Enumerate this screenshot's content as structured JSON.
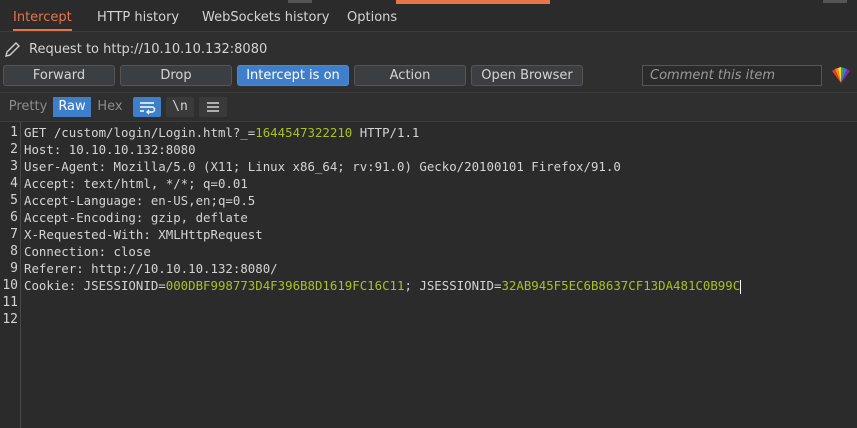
{
  "tabs": [
    {
      "label": "Intercept",
      "active": true
    },
    {
      "label": "HTTP history"
    },
    {
      "label": "WebSockets history"
    },
    {
      "label": "Options"
    }
  ],
  "request": {
    "title": "Request to http://10.10.10.132:8080"
  },
  "toolbar": {
    "forward": "Forward",
    "drop": "Drop",
    "intercept": "Intercept is on",
    "action": "Action",
    "open_browser": "Open Browser",
    "comment_placeholder": "Comment this item"
  },
  "view": {
    "pretty": "Pretty",
    "raw": "Raw",
    "hex": "Hex",
    "newline_toggle": "\\n",
    "selected": "Raw"
  },
  "colors": {
    "accent": "#e8744a",
    "selected": "#3f7fc9",
    "number_highlight": "#a8c023"
  },
  "editor": {
    "line_numbers": [
      "1",
      "2",
      "3",
      "4",
      "5",
      "6",
      "7",
      "8",
      "9",
      "10",
      "11",
      "12"
    ],
    "lines": [
      {
        "segments": [
          {
            "text": "GET /custom/login/Login.html?_="
          },
          {
            "text": "1644547322210",
            "num": true
          },
          {
            "text": " HTTP/1.1"
          }
        ]
      },
      {
        "segments": [
          {
            "text": "Host: 10.10.10.132:8080"
          }
        ]
      },
      {
        "segments": [
          {
            "text": "User-Agent: Mozilla/5.0 (X11; Linux x86_64; rv:91.0) Gecko/20100101 Firefox/91.0"
          }
        ]
      },
      {
        "segments": [
          {
            "text": "Accept: text/html, */*; q=0.01"
          }
        ]
      },
      {
        "segments": [
          {
            "text": "Accept-Language: en-US,en;q=0.5"
          }
        ]
      },
      {
        "segments": [
          {
            "text": "Accept-Encoding: gzip, deflate"
          }
        ]
      },
      {
        "segments": [
          {
            "text": "X-Requested-With: XMLHttpRequest"
          }
        ]
      },
      {
        "segments": [
          {
            "text": "Connection: close"
          }
        ]
      },
      {
        "segments": [
          {
            "text": "Referer: http://10.10.10.132:8080/"
          }
        ]
      },
      {
        "segments": [
          {
            "text": "Cookie: JSESSIONID="
          },
          {
            "text": "000DBF998773D4F396B8D1619FC16C11",
            "num": true
          },
          {
            "text": "; JSESSIONID="
          },
          {
            "text": "32AB945F5EC6B8637CF13DA481C0B99C",
            "num": true
          }
        ],
        "caret": true
      },
      {
        "segments": []
      },
      {
        "segments": []
      }
    ]
  }
}
